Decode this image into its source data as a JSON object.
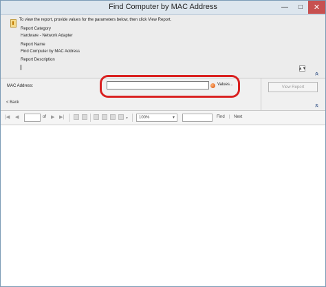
{
  "window": {
    "title": "Find Computer by MAC Address",
    "minimize_glyph": "—",
    "maximize_glyph": "□",
    "close_glyph": "✕"
  },
  "info": {
    "prompt": "To view the report, provide values for the parameters below, then click View Report.",
    "category_label": "Report Category",
    "category_value": "Hardware - Network Adapter",
    "name_label": "Report Name",
    "name_value": "Find Computer by MAC Address",
    "description_label": "Report Description"
  },
  "params": {
    "mac_label": "MAC Address:",
    "mac_value": "",
    "values_link": "Values...",
    "view_report": "View Report",
    "back": "< Back"
  },
  "toolbar": {
    "first": "|◀",
    "prev": "◀",
    "page_value": "",
    "of": "of",
    "next_page": "▶",
    "last": "▶|",
    "zoom": "100%",
    "zoom_arrow": "▼",
    "find_value": "",
    "find": "Find",
    "separator": "|",
    "next": "Next"
  },
  "icons": {
    "collapse": "»",
    "spin": "▲▼"
  },
  "colors": {
    "highlight": "#d9201f",
    "close_button": "#c75050",
    "collapse_arrow": "#1c3f7a"
  }
}
